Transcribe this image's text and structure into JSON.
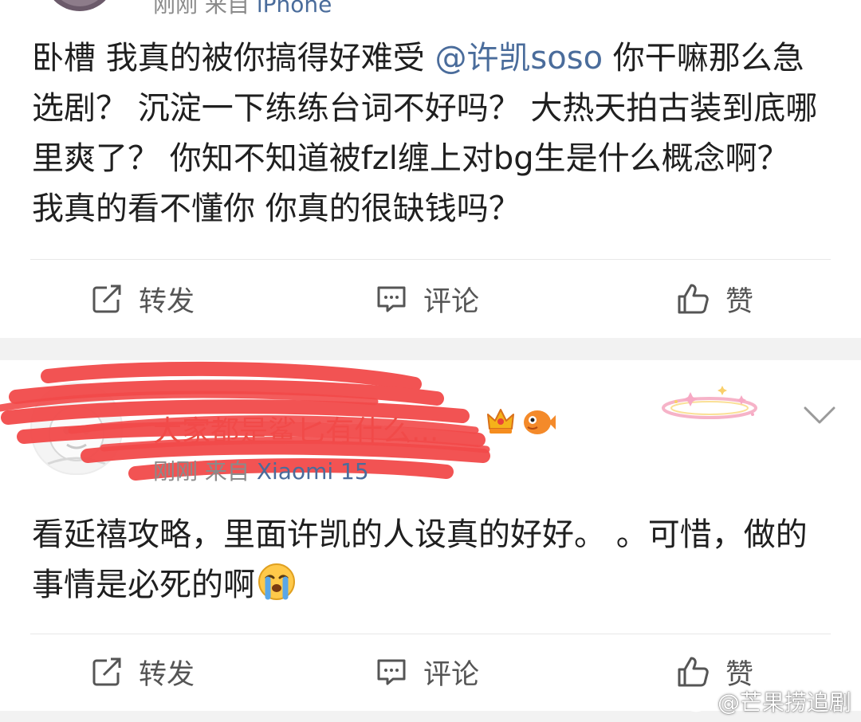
{
  "post1": {
    "meta_time": "刚刚",
    "meta_from": "来自",
    "meta_device": "iPhone",
    "text_before": "卧槽 我真的被你搞得好难受 ",
    "mention": "@许凯soso",
    "text_after": " 你干嘛那么急选剧？ 沉淀一下练练台词不好吗？ 大热天拍古装到底哪里爽了？ 你知不知道被fzl缠上对bg生是什么概念啊？ 我真的看不懂你 你真的很缺钱吗？",
    "actions": {
      "repost": "转发",
      "comment": "评论",
      "like": "赞"
    }
  },
  "post2": {
    "username": "大家都是鲨匕有什么...",
    "meta_time": "刚刚",
    "meta_from": "来自",
    "meta_device": "Xiaomi 15",
    "text": "看延禧攻略，里面许凯的人设真的好好。 。可惜，做的事情是必死的啊",
    "actions": {
      "repost": "转发",
      "comment": "评论",
      "like": "赞"
    }
  },
  "watermark": "@芒果捞追剧",
  "colors": {
    "link": "#4a6c9b",
    "username": "#e84a3c",
    "scribble": "#f24a4a",
    "gap": "#f2f2f2"
  }
}
